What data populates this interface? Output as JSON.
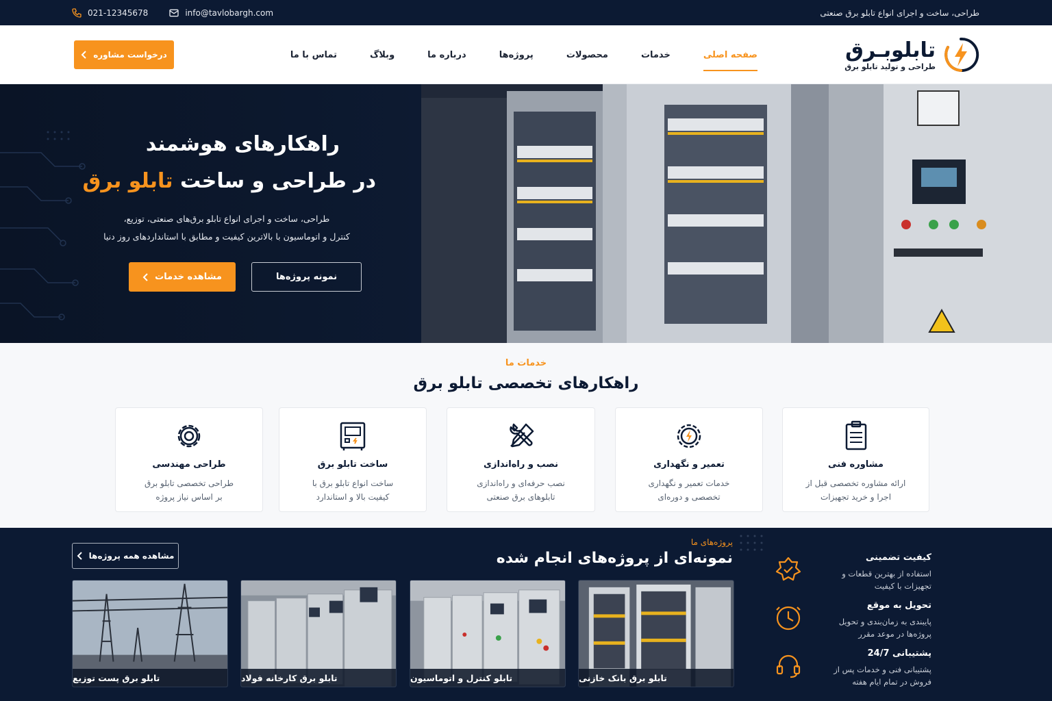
{
  "topbar": {
    "phone": "021-12345678",
    "email": "info@tavlobargh.com",
    "tagline": "طراحی، ساخت و اجرای انواع تابلو برق صنعتی"
  },
  "header": {
    "logo_brand": "تابلوبـرق",
    "logo_sub": "طراحی و تولید تابلو برق",
    "cta": "درخواست مشاوره",
    "nav": [
      "صفحه اصلی",
      "خدمات",
      "محصولات",
      "پروژه‌ها",
      "درباره ما",
      "وبلاگ",
      "تماس با ما"
    ],
    "active_nav": "صفحه اصلی"
  },
  "hero": {
    "title_line1": "راهکارهای هوشمند",
    "title_line2_prefix": "در طراحی و ساخت",
    "title_line2_highlight": "تابلو برق",
    "desc_line1": "طراحی، ساخت و اجرای انواع تابلو برق‌های صنعتی، توزیع،",
    "desc_line2": "کنترل و اتوماسیون با بالاترین کیفیت و مطابق با استانداردهای روز دنیا",
    "btn_primary": "مشاهده خدمات",
    "btn_secondary": "نمونه پروژه‌ها"
  },
  "services": {
    "kicker": "خدمات ما",
    "heading": "راهکارهای تخصصی تابلو برق",
    "cards": [
      {
        "title": "مشاوره فنی",
        "desc1": "ارائه مشاوره تخصصی قبل از",
        "desc2": "اجرا و خرید تجهیزات",
        "icon": "clipboard-icon"
      },
      {
        "title": "تعمیر و نگهداری",
        "desc1": "خدمات تعمیر و نگهداری",
        "desc2": "تخصصی و دوره‌ای",
        "icon": "gear-bolt-icon"
      },
      {
        "title": "نصب و راه‌اندازی",
        "desc1": "نصب حرفه‌ای و راه‌اندازی",
        "desc2": "تابلوهای برق صنعتی",
        "icon": "tools-icon"
      },
      {
        "title": "ساخت تابلو برق",
        "desc1": "ساخت انواع تابلو برق با",
        "desc2": "کیفیت بالا و استاندارد",
        "icon": "panel-icon"
      },
      {
        "title": "طراحی مهندسی",
        "desc1": "طراحی تخصصی تابلو برق",
        "desc2": "بر اساس نیاز پروژه",
        "icon": "gear-icon"
      }
    ]
  },
  "projects": {
    "kicker": "پروژه‌های ما",
    "heading": "نمونه‌ای از پروژه‌های انجام شده",
    "all_button": "مشاهده همه پروژه‌ها",
    "items": [
      {
        "label": "تابلو برق بانک خازنی"
      },
      {
        "label": "تابلو کنترل و اتوماسیون"
      },
      {
        "label": "تابلو برق کارخانه فولاد"
      },
      {
        "label": "تابلو برق پست توزیع"
      }
    ],
    "features": [
      {
        "title": "کیفیت تضمینی",
        "desc": "استفاده از بهترین قطعات و تجهیزات با کیفیت",
        "icon": "quality-badge-icon"
      },
      {
        "title": "تحویل به موقع",
        "desc": "پایبندی به زمان‌بندی و تحویل پروژه‌ها در موعد مقرر",
        "icon": "clock-icon"
      },
      {
        "title": "پشتیبانی 24/7",
        "desc": "پشتیبانی فنی و خدمات پس از فروش در تمام ایام هفته",
        "icon": "headset-icon"
      }
    ]
  },
  "colors": {
    "accent": "#f7931e",
    "navy": "#0c1a33"
  }
}
